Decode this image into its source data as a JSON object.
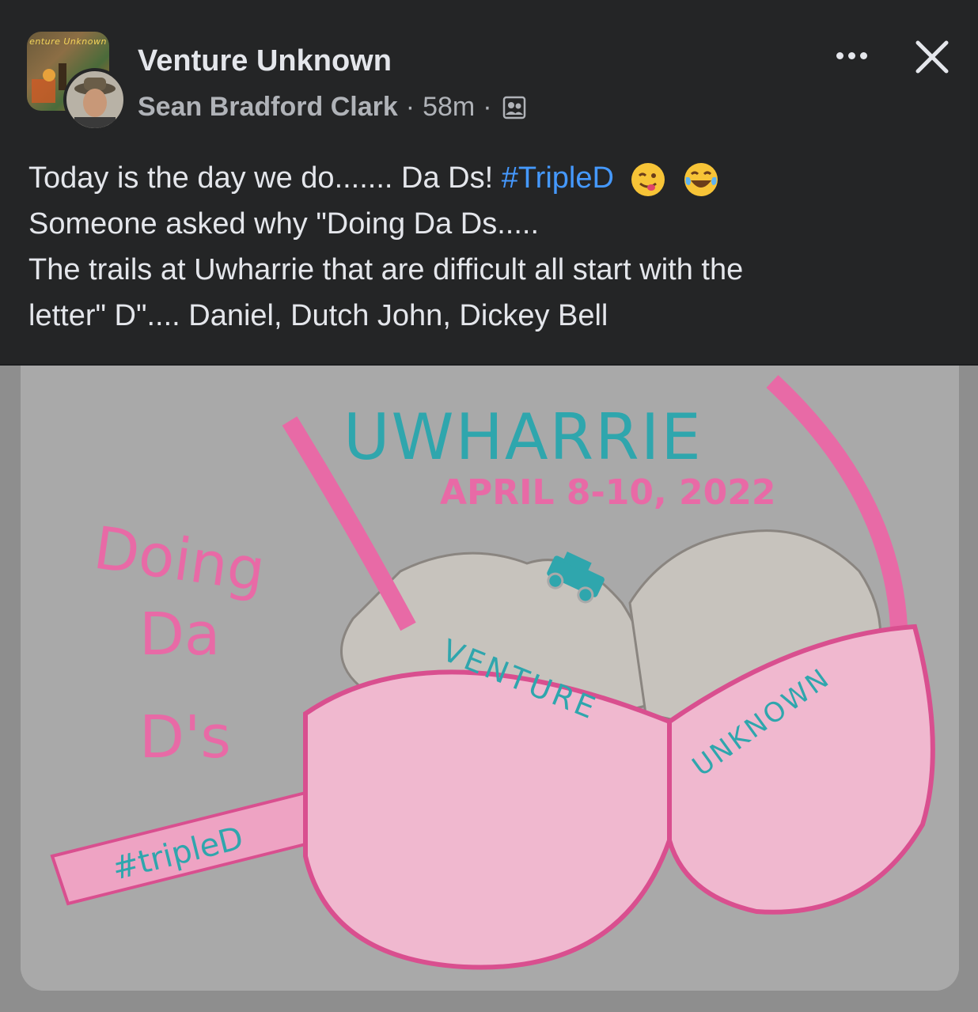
{
  "post": {
    "group_name": "Venture Unknown",
    "author": "Sean Bradford Clark",
    "separator": "·",
    "time": "58m",
    "group_avatar_text": "enture Unknown",
    "audience_icon": "group-members-icon",
    "more_icon": "more-options-icon",
    "close_icon": "close-icon",
    "text_line1_a": "Today is the day we do....... Da Ds! ",
    "hashtag": "#TripleD",
    "emoji1": "winking-face-tongue-emoji",
    "emoji2": "tears-of-joy-emoji",
    "text_line2": "Someone asked why \"Doing Da Ds.....",
    "text_line3": "The trails at Uwharrie that are difficult all start with the",
    "text_line4": "letter\" D\".... Daniel, Dutch John, Dickey Bell"
  },
  "image": {
    "title": "UWHARRIE",
    "date": "APRIL 8-10, 2022",
    "side_line1": "Doing",
    "side_line2": "Da",
    "side_line3": "D's",
    "strap_text": "#tripleD",
    "left_band": "VENTURE",
    "right_band": "UNKNOWN",
    "jeep_icon": "jeep-icon",
    "colors": {
      "pink": "#e86aa6",
      "teal": "#2fa6ad",
      "rock": "#c7c3bd",
      "bg": "#a9a9a9"
    }
  }
}
